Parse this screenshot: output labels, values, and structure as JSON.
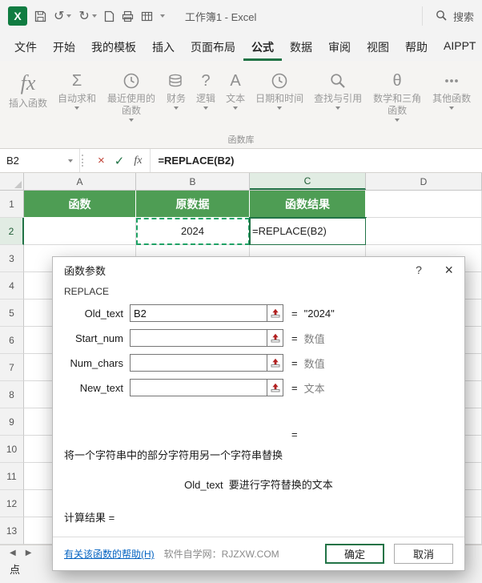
{
  "titlebar": {
    "app_icon": "X",
    "undo_icon": "↺",
    "redo_icon": "↻",
    "title": "工作簿1 - Excel",
    "search_label": "搜索"
  },
  "menu": {
    "tabs": [
      "文件",
      "开始",
      "我的模板",
      "插入",
      "页面布局",
      "公式",
      "数据",
      "审阅",
      "视图",
      "帮助",
      "AIPPT"
    ],
    "active_tab": "公式"
  },
  "ribbon": {
    "group_label": "函数库",
    "buttons": [
      {
        "label": "插入函数",
        "icon": "insert-function-icon",
        "glyph": "fx",
        "dropdown": false
      },
      {
        "label": "自动求和",
        "icon": "autosum-icon",
        "glyph": "Σ",
        "dropdown": true
      },
      {
        "label": "最近使用的函数",
        "icon": "recent-functions-icon",
        "glyph": "@clock",
        "dropdown": true
      },
      {
        "label": "财务",
        "icon": "financial-icon",
        "glyph": "@coins",
        "dropdown": true
      },
      {
        "label": "逻辑",
        "icon": "logical-icon",
        "glyph": "?",
        "dropdown": true
      },
      {
        "label": "文本",
        "icon": "text-icon",
        "glyph": "A",
        "dropdown": true
      },
      {
        "label": "日期和时间",
        "icon": "datetime-icon",
        "glyph": "@clock",
        "dropdown": true
      },
      {
        "label": "查找与引用",
        "icon": "lookup-reference-icon",
        "glyph": "@magnifier",
        "dropdown": true
      },
      {
        "label": "数学和三角函数",
        "icon": "math-trig-icon",
        "glyph": "θ",
        "dropdown": true
      },
      {
        "label": "其他函数",
        "icon": "more-functions-icon",
        "glyph": "@dots",
        "dropdown": true
      }
    ]
  },
  "formula_bar": {
    "name_box": "B2",
    "cancel_icon": "×",
    "enter_icon": "✓",
    "fx_icon": "fx",
    "formula": "=REPLACE(B2)"
  },
  "sheet": {
    "col_headers": [
      "A",
      "B",
      "C",
      "D"
    ],
    "row_headers": [
      "1",
      "2",
      "3",
      "4",
      "5",
      "6",
      "7",
      "8",
      "9",
      "10",
      "11",
      "12",
      "13"
    ],
    "active_col": "C",
    "active_row": "2",
    "cells": [
      {
        "ref": "A1",
        "text": "函数",
        "style": "header"
      },
      {
        "ref": "B1",
        "text": "原数据",
        "style": "header"
      },
      {
        "ref": "C1",
        "text": "函数结果",
        "style": "header"
      },
      {
        "ref": "B2",
        "text": "2024",
        "style": "ants"
      },
      {
        "ref": "C2",
        "text": "=REPLACE(B2)",
        "style": "active"
      }
    ]
  },
  "statusbar": {
    "prev_icon": "◀",
    "next_icon": "▶",
    "label": "点"
  },
  "dialog": {
    "title": "函数参数",
    "help_button": "?",
    "close_button": "×",
    "function_name": "REPLACE",
    "fields": [
      {
        "label": "Old_text",
        "value": "B2",
        "eq": "=",
        "result": "\"2024\"",
        "result_kind": "value"
      },
      {
        "label": "Start_num",
        "value": "",
        "eq": "=",
        "result": "数值",
        "result_kind": "hint"
      },
      {
        "label": "Num_chars",
        "value": "",
        "eq": "=",
        "result": "数值",
        "result_kind": "hint"
      },
      {
        "label": "New_text",
        "value": "",
        "eq": "=",
        "result": "文本",
        "result_kind": "hint"
      }
    ],
    "result_eq": "=",
    "description": "将一个字符串中的部分字符用另一个字符串替换",
    "field_hint": "Old_text  要进行字符替换的文本",
    "calc_result_label": "计算结果 =",
    "help_link": "有关该函数的帮助(H)",
    "brand_text": "软件自学网：RJZXW.COM",
    "ok_label": "确定",
    "cancel_label": "取消"
  }
}
